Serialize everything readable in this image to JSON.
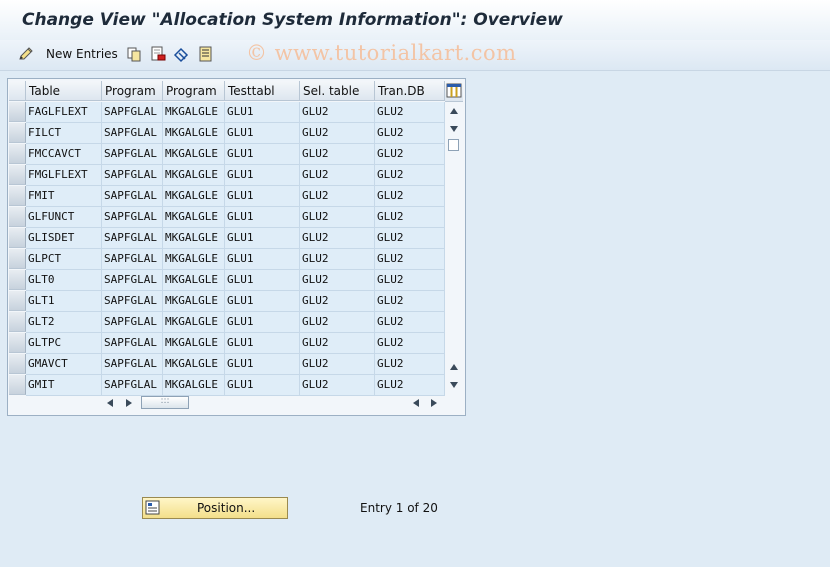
{
  "window": {
    "title": "Change View \"Allocation System Information\": Overview"
  },
  "toolbar": {
    "new_entries_label": "New Entries",
    "watermark": "© www.tutorialkart.com"
  },
  "table": {
    "columns": [
      "Table",
      "Program",
      "Program",
      "Testtabl",
      "Sel. table",
      "Tran.DB"
    ],
    "rows": [
      [
        "FAGLFLEXT",
        "SAPFGLAL",
        "MKGALGLE",
        "GLU1",
        "GLU2",
        "GLU2"
      ],
      [
        "FILCT",
        "SAPFGLAL",
        "MKGALGLE",
        "GLU1",
        "GLU2",
        "GLU2"
      ],
      [
        "FMCCAVCT",
        "SAPFGLAL",
        "MKGALGLE",
        "GLU1",
        "GLU2",
        "GLU2"
      ],
      [
        "FMGLFLEXT",
        "SAPFGLAL",
        "MKGALGLE",
        "GLU1",
        "GLU2",
        "GLU2"
      ],
      [
        "FMIT",
        "SAPFGLAL",
        "MKGALGLE",
        "GLU1",
        "GLU2",
        "GLU2"
      ],
      [
        "GLFUNCT",
        "SAPFGLAL",
        "MKGALGLE",
        "GLU1",
        "GLU2",
        "GLU2"
      ],
      [
        "GLISDET",
        "SAPFGLAL",
        "MKGALGLE",
        "GLU1",
        "GLU2",
        "GLU2"
      ],
      [
        "GLPCT",
        "SAPFGLAL",
        "MKGALGLE",
        "GLU1",
        "GLU2",
        "GLU2"
      ],
      [
        "GLT0",
        "SAPFGLAL",
        "MKGALGLE",
        "GLU1",
        "GLU2",
        "GLU2"
      ],
      [
        "GLT1",
        "SAPFGLAL",
        "MKGALGLE",
        "GLU1",
        "GLU2",
        "GLU2"
      ],
      [
        "GLT2",
        "SAPFGLAL",
        "MKGALGLE",
        "GLU1",
        "GLU2",
        "GLU2"
      ],
      [
        "GLTPC",
        "SAPFGLAL",
        "MKGALGLE",
        "GLU1",
        "GLU2",
        "GLU2"
      ],
      [
        "GMAVCT",
        "SAPFGLAL",
        "MKGALGLE",
        "GLU1",
        "GLU2",
        "GLU2"
      ],
      [
        "GMIT",
        "SAPFGLAL",
        "MKGALGLE",
        "GLU1",
        "GLU2",
        "GLU2"
      ]
    ]
  },
  "footer": {
    "position_label": "Position...",
    "entry_text": "Entry 1 of 20"
  }
}
